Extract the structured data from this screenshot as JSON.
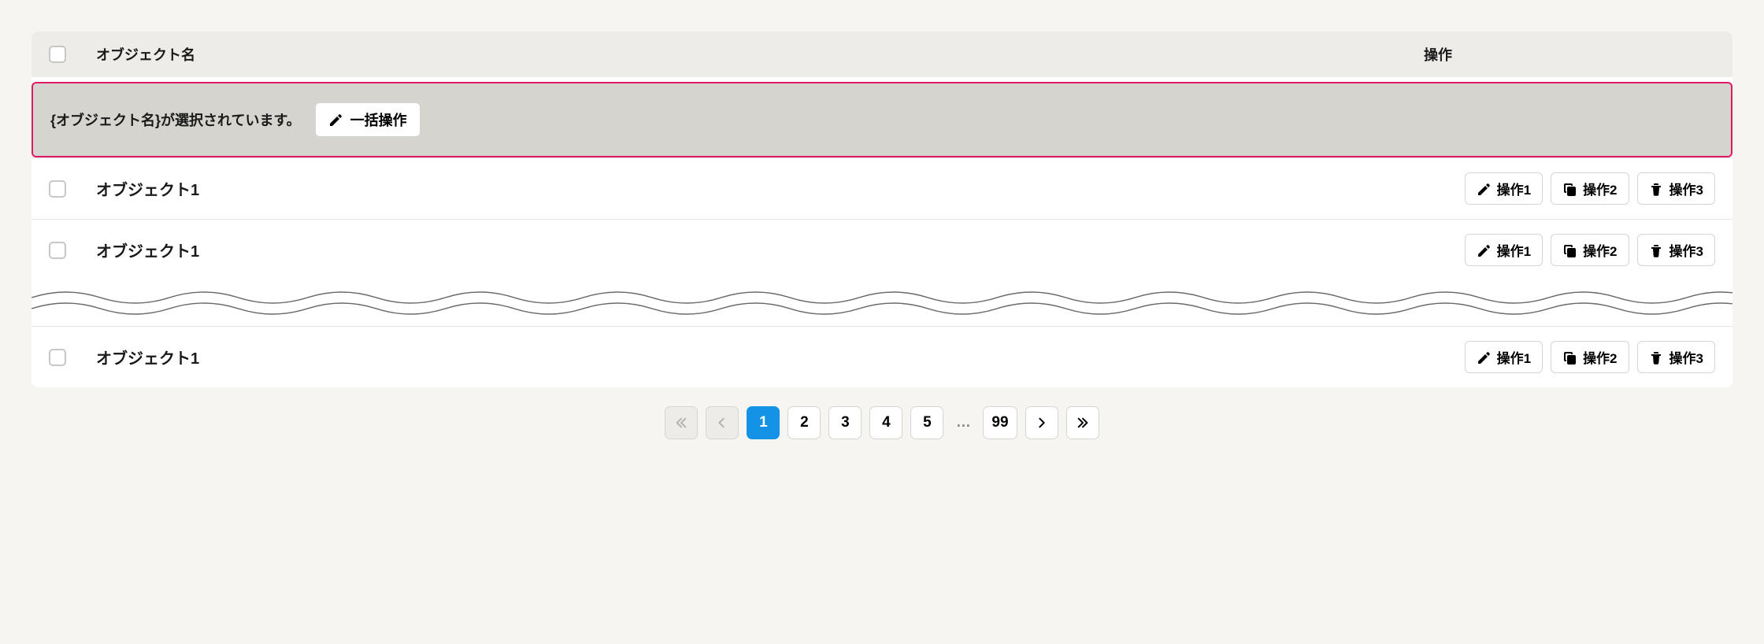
{
  "header": {
    "name_col": "オブジェクト名",
    "actions_col": "操作"
  },
  "selection_bar": {
    "message": "{オブジェクト名}が選択されています。",
    "bulk_label": "一括操作"
  },
  "action_labels": {
    "edit": "操作1",
    "copy": "操作2",
    "delete": "操作3"
  },
  "rows": [
    {
      "name": "オブジェクト1"
    },
    {
      "name": "オブジェクト1"
    },
    {
      "name": "オブジェクト1"
    }
  ],
  "pagination": {
    "pages": [
      "1",
      "2",
      "3",
      "4",
      "5"
    ],
    "ellipsis": "…",
    "last": "99",
    "active": "1"
  }
}
